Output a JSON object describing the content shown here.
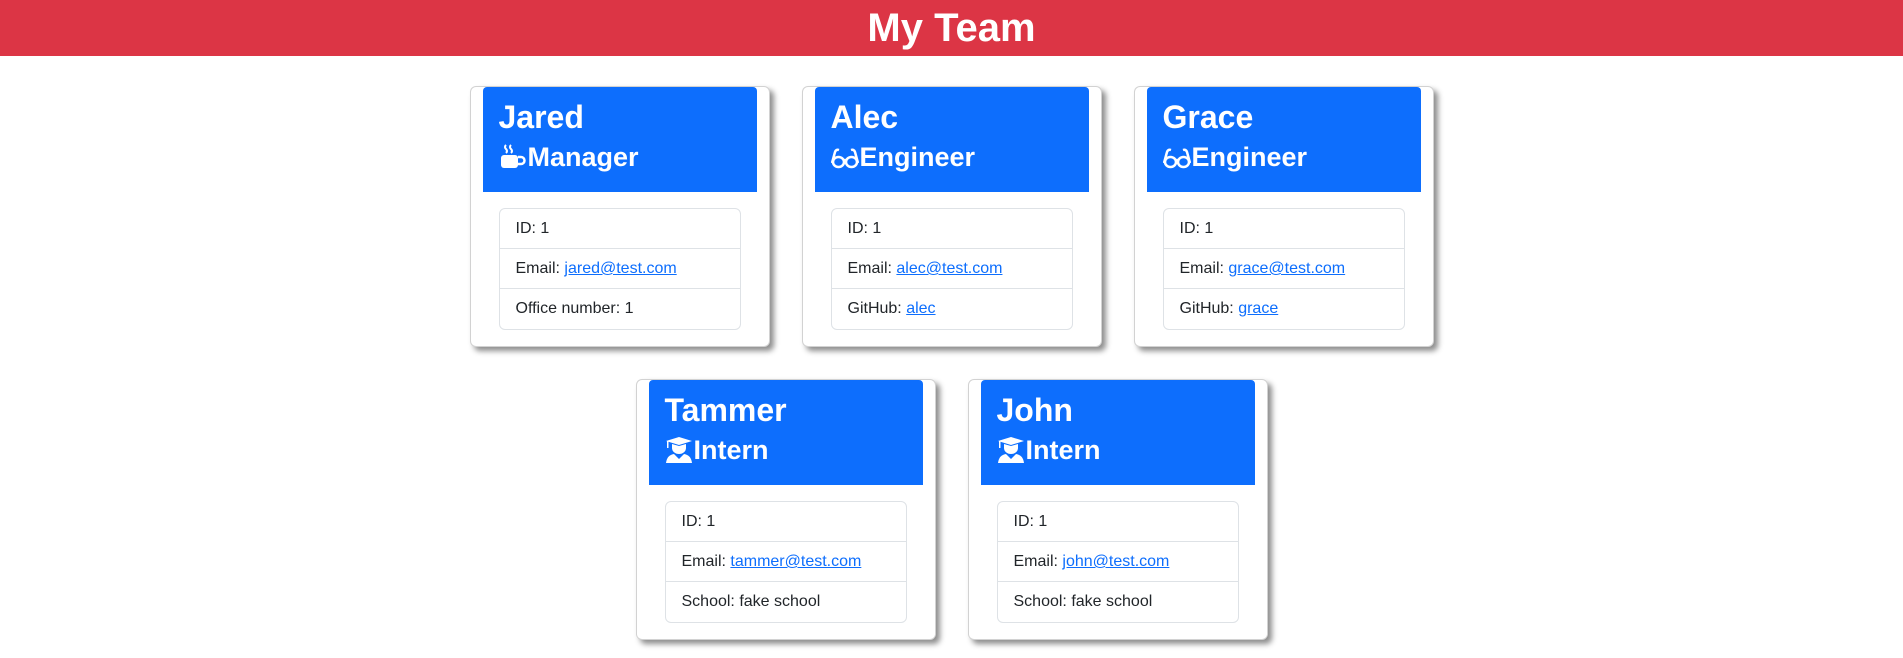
{
  "header": {
    "title": "My Team"
  },
  "colors": {
    "header_bar": "#dc3545",
    "card_header": "#0d6efd",
    "link": "#0d6efd"
  },
  "members": [
    {
      "name": "Jared",
      "role": "Manager",
      "role_icon": "mug-hot-icon",
      "id_label": "ID:",
      "id": "1",
      "email_label": "Email:",
      "email": "jared@test.com",
      "extra_label": "Office number:",
      "extra_value": "1"
    },
    {
      "name": "Alec",
      "role": "Engineer",
      "role_icon": "glasses-icon",
      "id_label": "ID:",
      "id": "1",
      "email_label": "Email:",
      "email": "alec@test.com",
      "extra_label": "GitHub:",
      "extra_value": "alec"
    },
    {
      "name": "Grace",
      "role": "Engineer",
      "role_icon": "glasses-icon",
      "id_label": "ID:",
      "id": "1",
      "email_label": "Email:",
      "email": "grace@test.com",
      "extra_label": "GitHub:",
      "extra_value": "grace"
    },
    {
      "name": "Tammer",
      "role": "Intern",
      "role_icon": "graduate-icon",
      "id_label": "ID:",
      "id": "1",
      "email_label": "Email:",
      "email": "tammer@test.com",
      "extra_label": "School:",
      "extra_value": "fake school"
    },
    {
      "name": "John",
      "role": "Intern",
      "role_icon": "graduate-icon",
      "id_label": "ID:",
      "id": "1",
      "email_label": "Email:",
      "email": "john@test.com",
      "extra_label": "School:",
      "extra_value": "fake school"
    }
  ]
}
